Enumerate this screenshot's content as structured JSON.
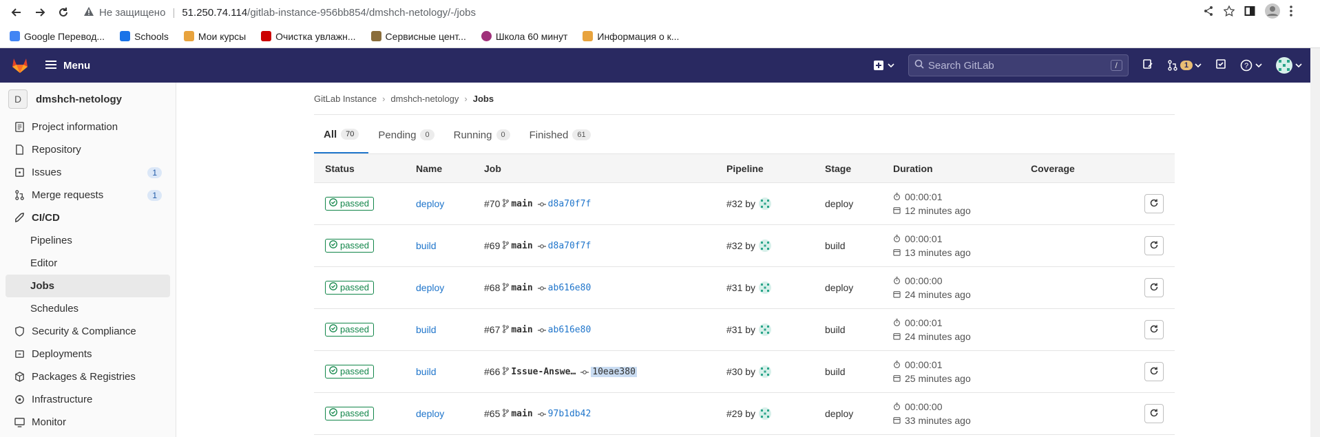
{
  "browser": {
    "insecure_label": "Не защищено",
    "url_host": "51.250.74.114",
    "url_path": "/gitlab-instance-956bb854/dmshch-netology/-/jobs",
    "bookmarks": [
      {
        "label": "Google Перевод...",
        "color": "#4285f4"
      },
      {
        "label": "Schools",
        "color": "#1a73e8"
      },
      {
        "label": "Мои курсы",
        "color": "#e8a33d"
      },
      {
        "label": "Очистка увлажн...",
        "color": "#c00"
      },
      {
        "label": "Сервисные цент...",
        "color": "#8a6d3b"
      },
      {
        "label": "Школа 60 минут",
        "color": "#a0307a"
      },
      {
        "label": "Информация о к...",
        "color": "#e8a33d"
      }
    ]
  },
  "topnav": {
    "menu_label": "Menu",
    "search_placeholder": "Search GitLab",
    "search_shortcut": "/",
    "mr_count": "1"
  },
  "sidebar": {
    "project_initial": "D",
    "project_name": "dmshch-netology",
    "items": [
      {
        "label": "Project information",
        "icon": "info-icon"
      },
      {
        "label": "Repository",
        "icon": "doc-icon"
      },
      {
        "label": "Issues",
        "icon": "issues-icon",
        "count": "1"
      },
      {
        "label": "Merge requests",
        "icon": "merge-icon",
        "count": "1"
      },
      {
        "label": "CI/CD",
        "icon": "rocket-icon"
      }
    ],
    "cicd_sub": [
      "Pipelines",
      "Editor",
      "Jobs",
      "Schedules"
    ],
    "after": [
      {
        "label": "Security & Compliance",
        "icon": "shield-icon"
      },
      {
        "label": "Deployments",
        "icon": "deploy-icon"
      },
      {
        "label": "Packages & Registries",
        "icon": "package-icon"
      },
      {
        "label": "Infrastructure",
        "icon": "infra-icon"
      },
      {
        "label": "Monitor",
        "icon": "monitor-icon"
      }
    ]
  },
  "breadcrumb": {
    "root": "GitLab Instance",
    "project": "dmshch-netology",
    "current": "Jobs"
  },
  "tabs": [
    {
      "label": "All",
      "count": "70"
    },
    {
      "label": "Pending",
      "count": "0"
    },
    {
      "label": "Running",
      "count": "0"
    },
    {
      "label": "Finished",
      "count": "61"
    }
  ],
  "table": {
    "headers": {
      "status": "Status",
      "name": "Name",
      "job": "Job",
      "pipeline": "Pipeline",
      "stage": "Stage",
      "duration": "Duration",
      "coverage": "Coverage"
    },
    "rows": [
      {
        "status": "passed",
        "name": "deploy",
        "job_id": "#70",
        "branch": "main",
        "sha": "d8a70f7f",
        "pipeline": "#32 by",
        "stage": "deploy",
        "duration": "00:00:01",
        "finished": "12 minutes ago"
      },
      {
        "status": "passed",
        "name": "build",
        "job_id": "#69",
        "branch": "main",
        "sha": "d8a70f7f",
        "pipeline": "#32 by",
        "stage": "build",
        "duration": "00:00:01",
        "finished": "13 minutes ago"
      },
      {
        "status": "passed",
        "name": "deploy",
        "job_id": "#68",
        "branch": "main",
        "sha": "ab616e80",
        "pipeline": "#31 by",
        "stage": "deploy",
        "duration": "00:00:00",
        "finished": "24 minutes ago"
      },
      {
        "status": "passed",
        "name": "build",
        "job_id": "#67",
        "branch": "main",
        "sha": "ab616e80",
        "pipeline": "#31 by",
        "stage": "build",
        "duration": "00:00:01",
        "finished": "24 minutes ago"
      },
      {
        "status": "passed",
        "name": "build",
        "job_id": "#66",
        "branch": "Issue-Answe…",
        "sha": "10eae380",
        "pipeline": "#30 by",
        "stage": "build",
        "duration": "00:00:01",
        "finished": "25 minutes ago"
      },
      {
        "status": "passed",
        "name": "deploy",
        "job_id": "#65",
        "branch": "main",
        "sha": "97b1db42",
        "pipeline": "#29 by",
        "stage": "deploy",
        "duration": "00:00:00",
        "finished": "33 minutes ago"
      }
    ]
  },
  "colors": {
    "topnav_bg": "#292961",
    "success": "#108548",
    "link": "#1f75cb"
  }
}
